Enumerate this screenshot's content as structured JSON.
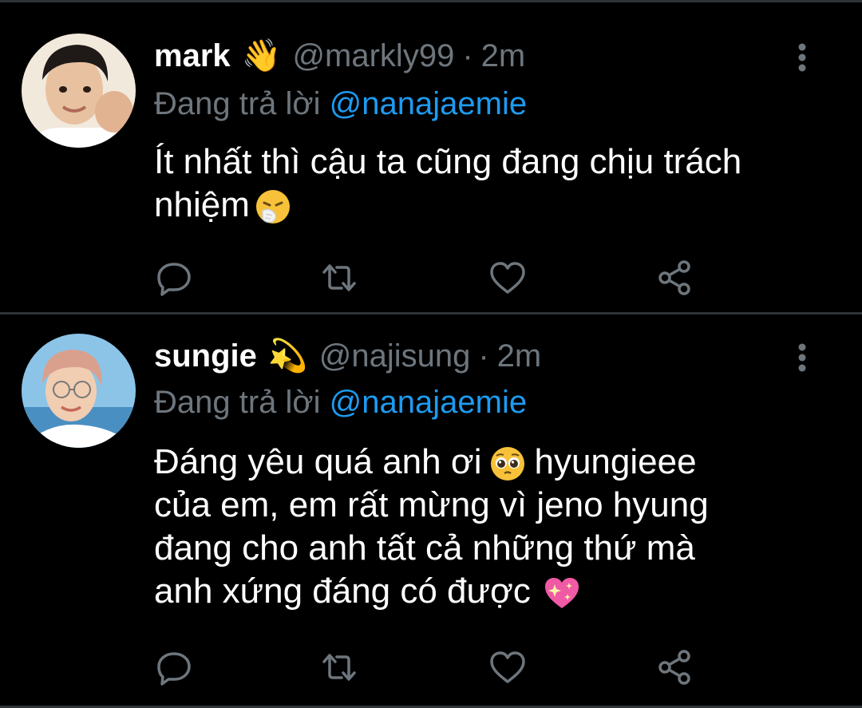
{
  "theme": {
    "background": "#000000",
    "text_primary": "#ffffff",
    "text_secondary": "#6e767d",
    "accent": "#1d9bf0",
    "divider": "#2f3336"
  },
  "tweets": [
    {
      "name": "mark",
      "badge_emoji": "👋",
      "handle": "@markly99",
      "separator": "·",
      "time": "2m",
      "replying_prefix": "Đang trả lời",
      "replying_to": "@nanajaemie",
      "text_lines": [
        "Ít nhất thì cậu ta cũng đang chịu trách",
        "nhiệm"
      ],
      "trailing_emoji": "sneezing-face",
      "icons": [
        "reply-icon",
        "retweet-icon",
        "like-icon",
        "share-icon",
        "more-icon"
      ]
    },
    {
      "name": "sungie",
      "badge_emoji": "💫",
      "handle": "@najisung",
      "separator": "·",
      "time": "2m",
      "replying_prefix": "Đang trả lời",
      "replying_to": "@nanajaemie",
      "text_lines": [
        "Đáng yêu quá anh ơi",
        "của em, em rất mừng vì jeno hyung",
        "đang cho anh tất cả những thứ mà",
        "anh xứng đáng có được"
      ],
      "text_line1_after_emoji": "hyungieee",
      "inline_emoji": "pleading-face",
      "trailing_emoji": "sparkling-heart",
      "icons": [
        "reply-icon",
        "retweet-icon",
        "like-icon",
        "share-icon",
        "more-icon"
      ]
    }
  ]
}
